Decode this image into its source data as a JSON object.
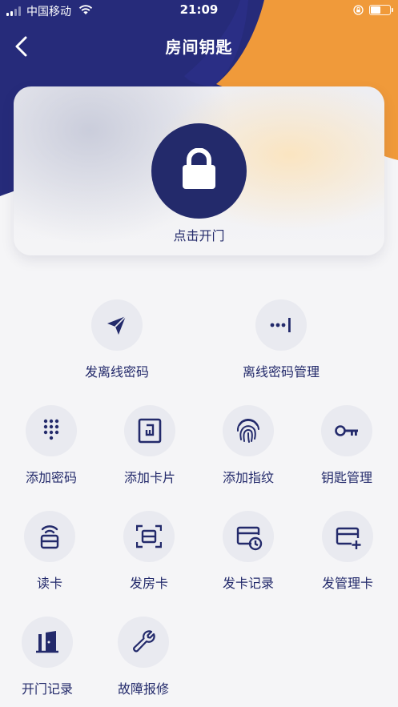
{
  "status_bar": {
    "carrier": "中国移动",
    "time": "21:09",
    "battery_percent": 55
  },
  "nav": {
    "title": "房间钥匙"
  },
  "card": {
    "unlock_label": "点击开门"
  },
  "colors": {
    "primary": "#232a6b",
    "accent": "#f09a3a",
    "icon_bg": "#e9eaf0",
    "page_bg": "#f5f5f7"
  },
  "actions": {
    "send_offline_password": {
      "label": "发离线密码",
      "icon": "send-icon"
    },
    "offline_password_manage": {
      "label": "离线密码管理",
      "icon": "password-dots-icon"
    },
    "add_password": {
      "label": "添加密码",
      "icon": "keypad-icon"
    },
    "add_card": {
      "label": "添加卡片",
      "icon": "card-chip-icon"
    },
    "add_fingerprint": {
      "label": "添加指纹",
      "icon": "fingerprint-icon"
    },
    "key_manage": {
      "label": "钥匙管理",
      "icon": "key-icon"
    },
    "read_card": {
      "label": "读卡",
      "icon": "card-reader-icon"
    },
    "issue_room_card": {
      "label": "发房卡",
      "icon": "scan-card-icon"
    },
    "issue_card_records": {
      "label": "发卡记录",
      "icon": "card-history-icon"
    },
    "issue_manage_card": {
      "label": "发管理卡",
      "icon": "card-add-icon"
    },
    "open_door_records": {
      "label": "开门记录",
      "icon": "door-icon"
    },
    "fault_repair": {
      "label": "故障报修",
      "icon": "wrench-icon"
    }
  }
}
